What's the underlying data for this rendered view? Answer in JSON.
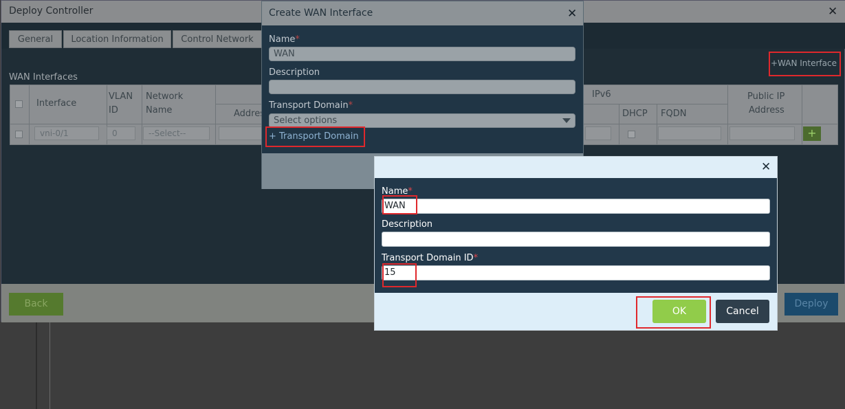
{
  "main_window": {
    "title": "Deploy Controller",
    "close_glyph": "✕",
    "tabs": [
      {
        "label": "General"
      },
      {
        "label": "Location Information"
      },
      {
        "label": "Control Network"
      }
    ],
    "wan_interfaces_label": "WAN Interfaces",
    "add_wan_interface_link": "+WAN Interface",
    "table": {
      "headers": {
        "interface": "Interface",
        "vlan_id_line1": "VLAN",
        "vlan_id_line2": "ID",
        "network_name_line1": "Network",
        "network_name_line2": "Name",
        "address": "Address",
        "ipv6": "IPv6",
        "dhcp": "DHCP",
        "fqdn": "FQDN",
        "public_ip_line1": "Public IP",
        "public_ip_line2": "Address"
      },
      "row": {
        "interface": "vni-0/1",
        "vlan_id": "0",
        "network_name": "--Select--"
      },
      "add_row_glyph": "+"
    },
    "back_button": "Back",
    "deploy_button": "Deploy"
  },
  "create_wan_dialog": {
    "title": "Create WAN Interface",
    "close_glyph": "✕",
    "name_label": "Name",
    "required_mark": "*",
    "name_value": "WAN",
    "description_label": "Description",
    "description_value": "",
    "transport_domain_label": "Transport Domain",
    "transport_domain_select": "Select options",
    "add_transport_domain_link": "+ Transport Domain"
  },
  "transport_domain_modal": {
    "close_glyph": "✕",
    "name_label": "Name",
    "required_mark": "*",
    "name_value": "WAN",
    "description_label": "Description",
    "description_value": "",
    "transport_domain_id_label": "Transport Domain ID",
    "transport_domain_id_value": "15",
    "ok_button": "OK",
    "cancel_button": "Cancel"
  },
  "colors": {
    "highlight_box": "#e0282c",
    "ok_button": "#91cc4a",
    "cancel_button": "#2f3f4c",
    "modal_header": "#dfeef8"
  }
}
